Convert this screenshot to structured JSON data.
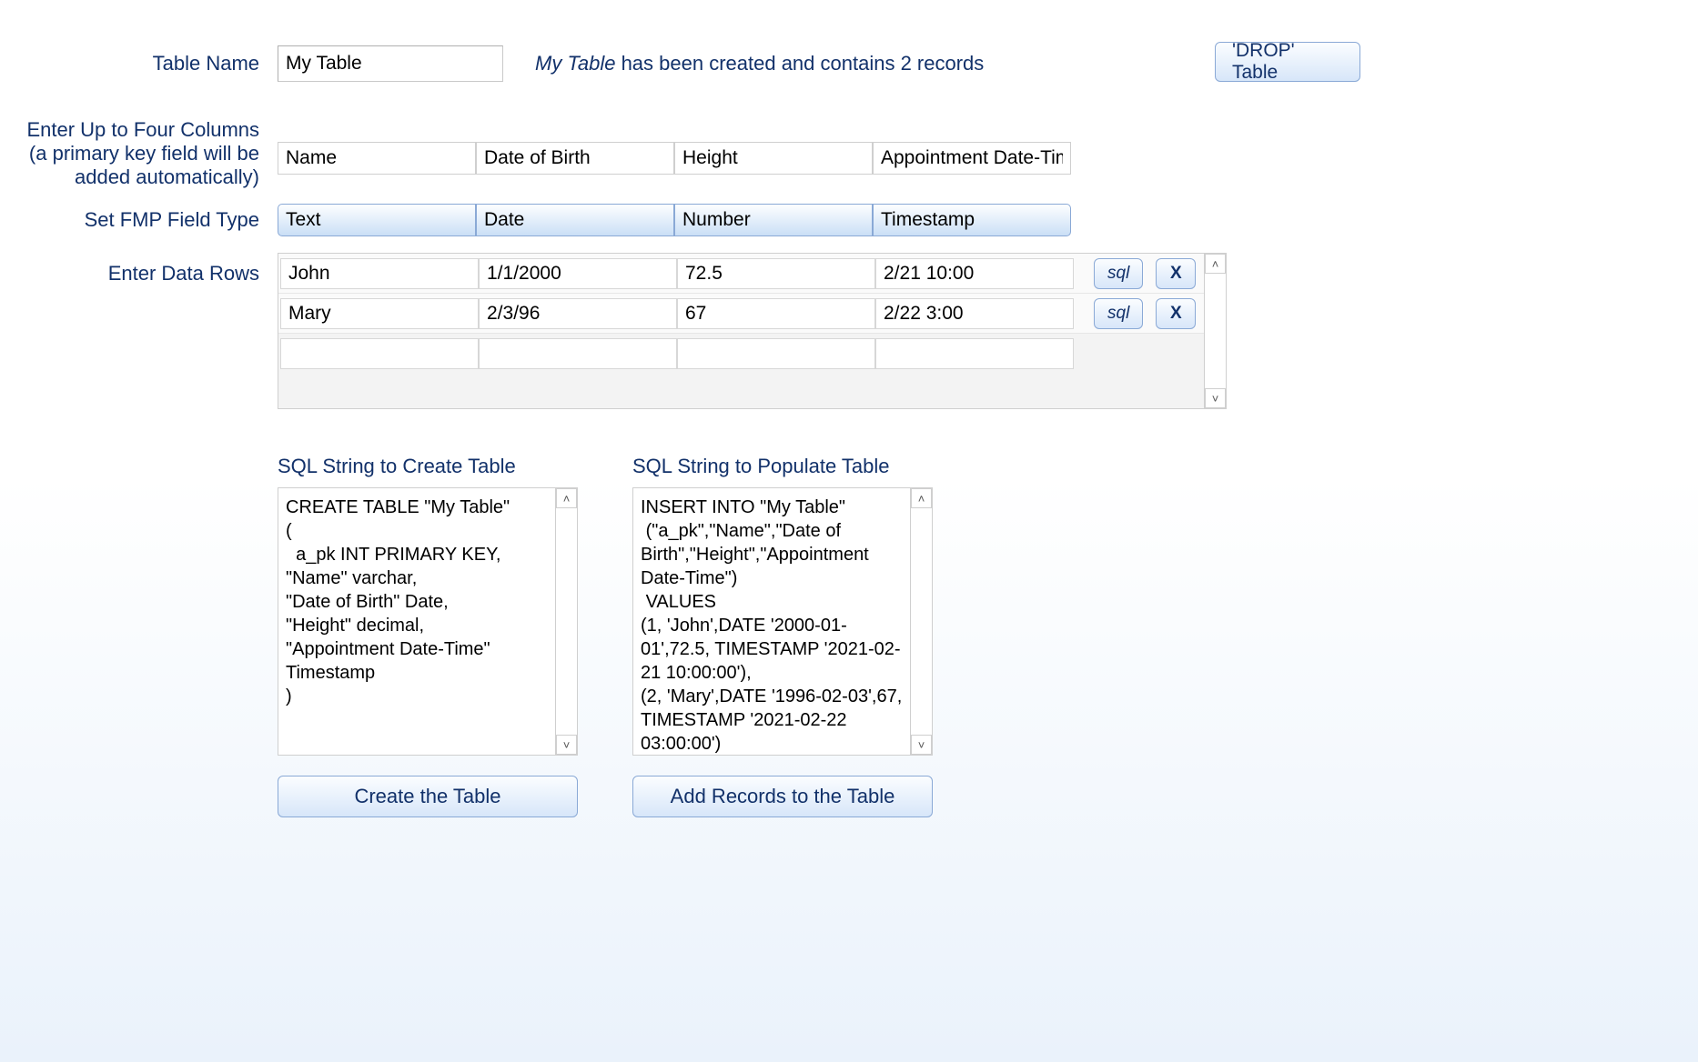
{
  "labels": {
    "table_name": "Table Name",
    "columns": "Enter Up to Four Columns",
    "columns_note": "(a primary key field will be added automatically)",
    "field_type": "Set  FMP Field Type",
    "data_rows": "Enter Data Rows"
  },
  "table_name_value": "My Table",
  "status": {
    "prefix_table": "My Table",
    "rest": " has been created and contains 2 records"
  },
  "buttons": {
    "drop": "'DROP' Table",
    "sql": "sql",
    "delete": "X",
    "create_title": "SQL String to Create Table",
    "populate_title": "SQL String to Populate Table",
    "create": "Create the Table",
    "add_records": "Add Records to the Table"
  },
  "scroll": {
    "up": "˄",
    "down": "˅"
  },
  "columns": [
    "Name",
    "Date of Birth",
    "Height",
    "Appointment Date-Time"
  ],
  "types": [
    "Text",
    "Date",
    "Number",
    "Timestamp"
  ],
  "rows": [
    {
      "c": [
        "John",
        "1/1/2000",
        "72.5",
        "2/21 10:00"
      ]
    },
    {
      "c": [
        "Mary",
        "2/3/96",
        "67",
        "2/22 3:00"
      ]
    },
    {
      "c": [
        "",
        "",
        "",
        ""
      ],
      "empty": true
    }
  ],
  "sql_create": "CREATE TABLE \"My Table\"\n(\n  a_pk INT PRIMARY KEY,\n\"Name\" varchar,\n\"Date of Birth\" Date,\n\"Height\" decimal,\n\"Appointment Date-Time\" Timestamp\n)",
  "sql_populate": "INSERT INTO \"My Table\"\n (\"a_pk\",\"Name\",\"Date of Birth\",\"Height\",\"Appointment Date-Time\")\n VALUES\n(1, 'John',DATE '2000-01-01',72.5, TIMESTAMP '2021-02-21 10:00:00'),\n(2, 'Mary',DATE '1996-02-03',67, TIMESTAMP '2021-02-22 03:00:00')"
}
